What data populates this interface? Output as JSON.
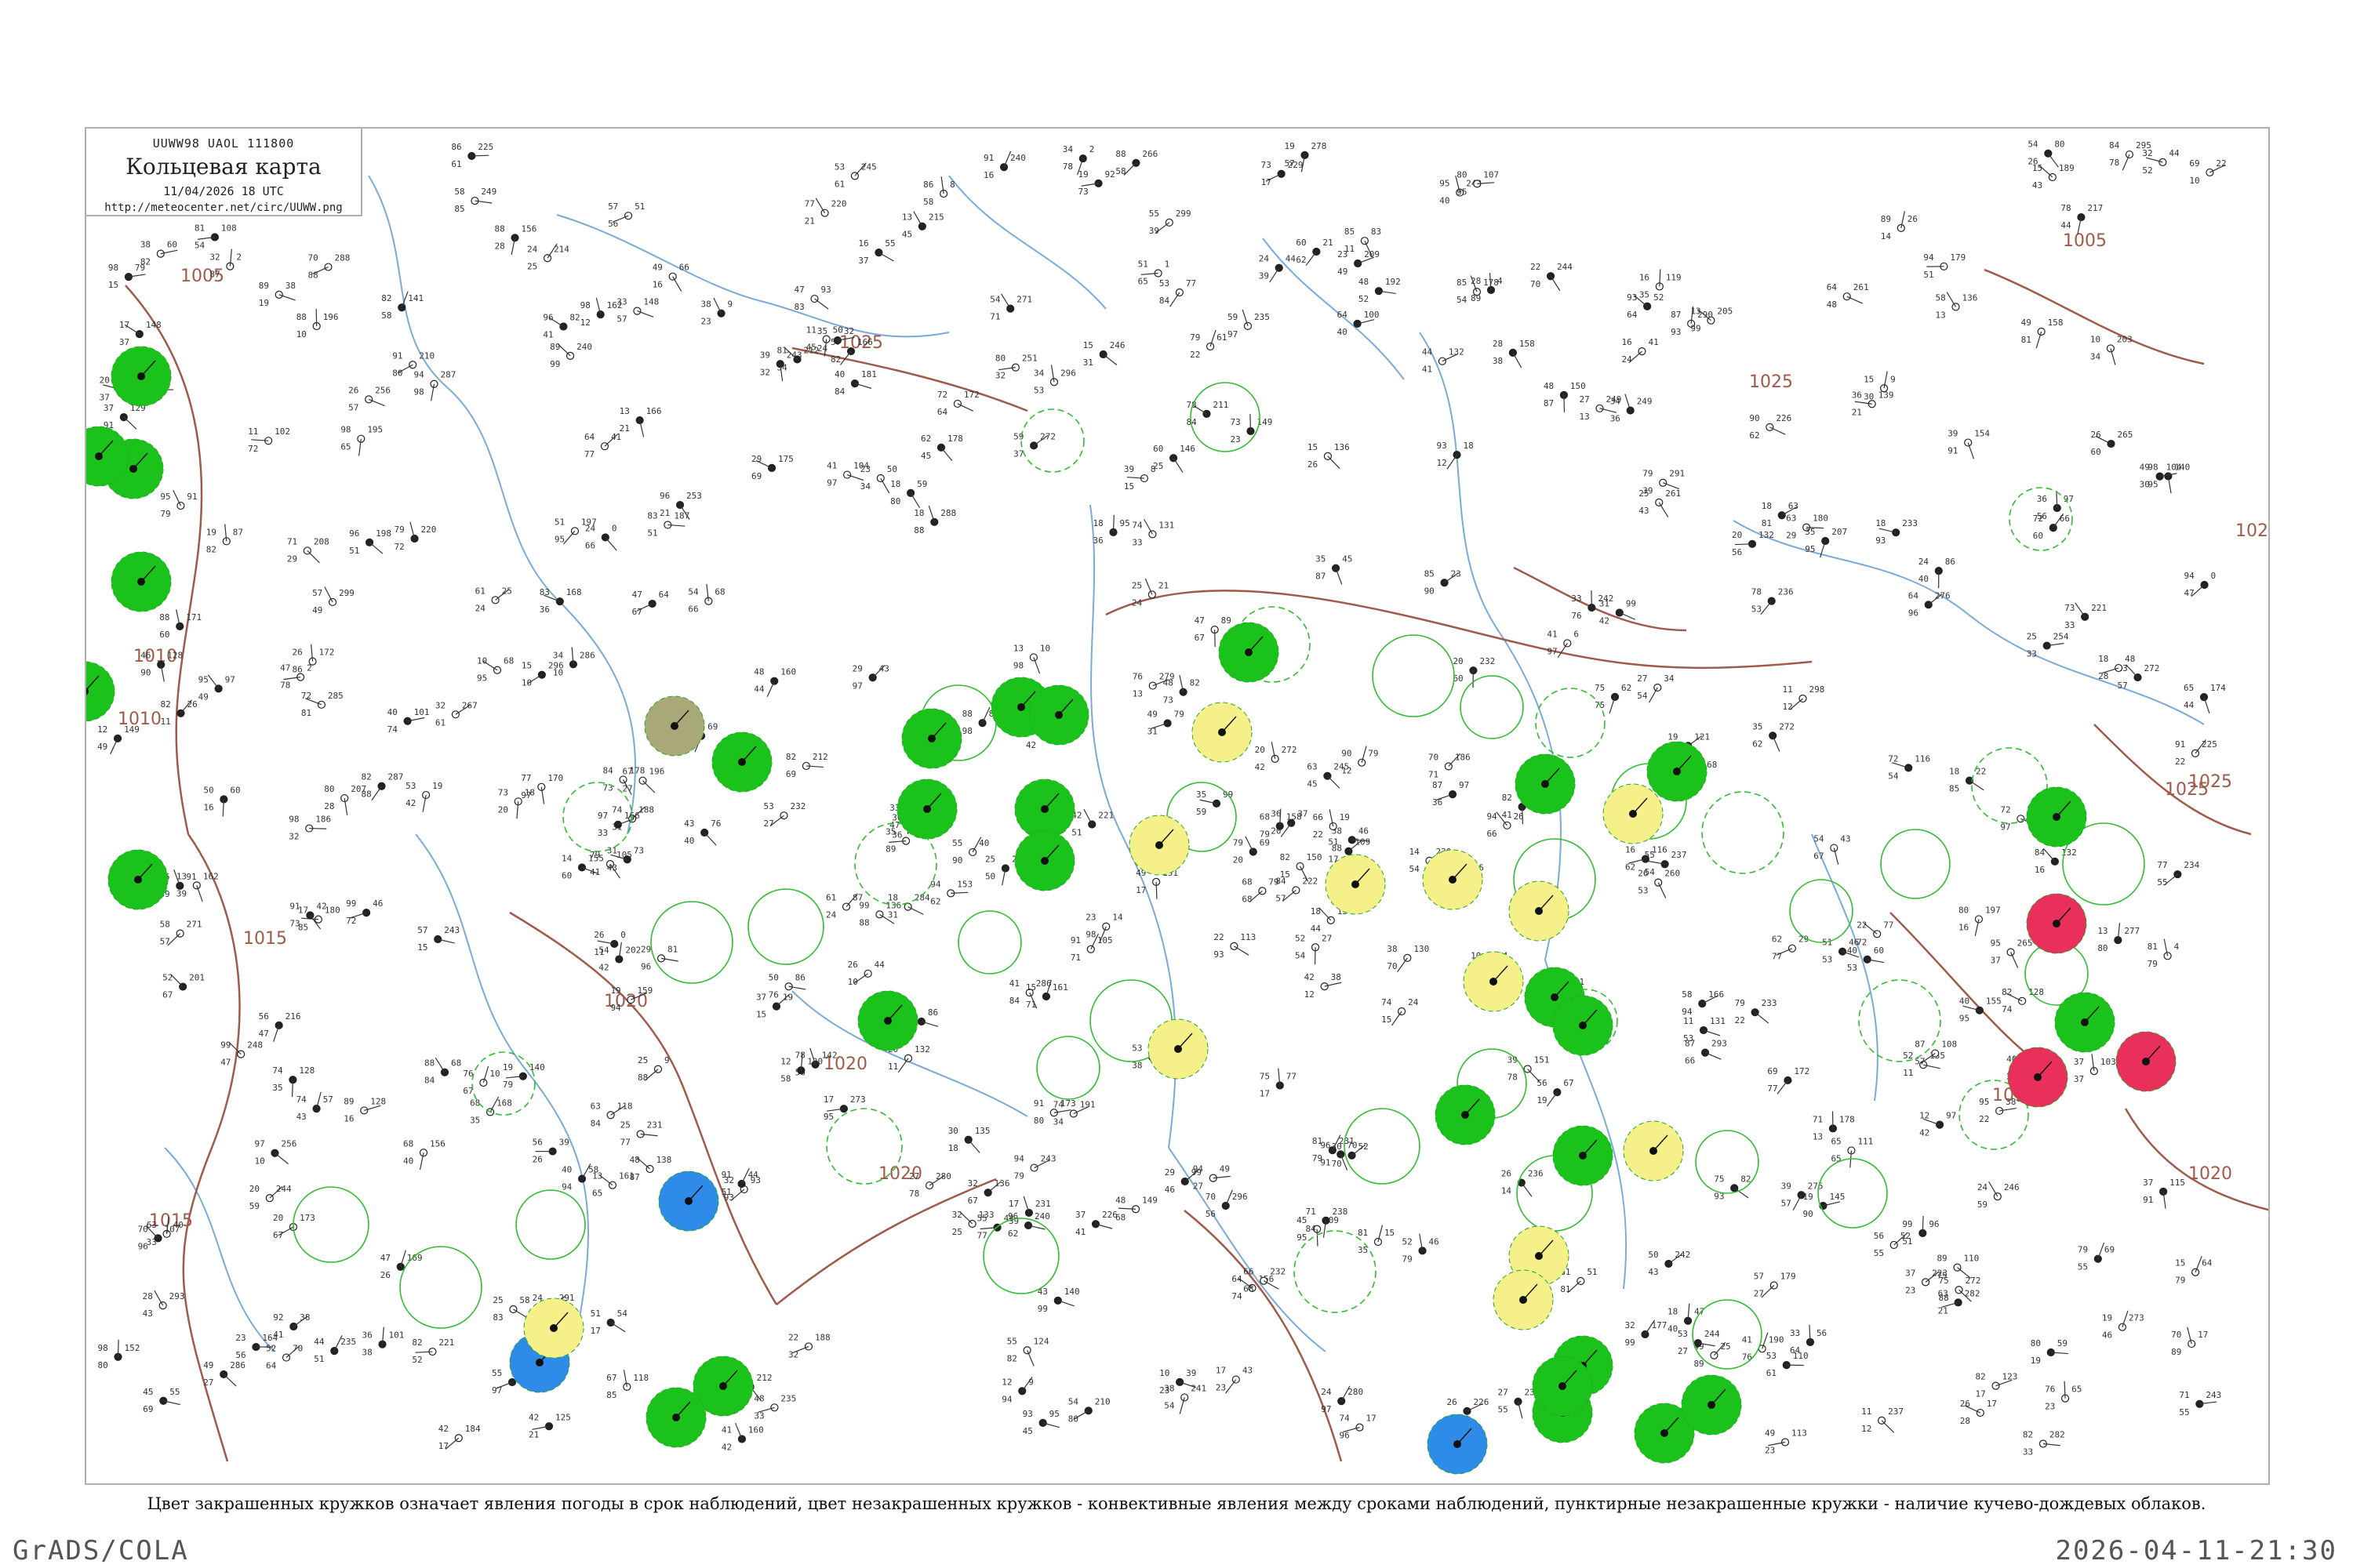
{
  "header": {
    "code": "UUWW98 UAOL 111800",
    "title": "Кольцевая карта",
    "datetime": "11/04/2026 18 UTC",
    "url": "http://meteocenter.net/circ/UUWW.png"
  },
  "legend": {
    "text": "Цвет закрашенных кружков означает явления погоды в срок наблюдений, цвет незакрашенных кружков - конвективные явления между сроками наблюдений, пунктирные незакрашенные кружки - наличие кучево-дождевых облаков."
  },
  "footer": {
    "left": "GrADS/COLA",
    "right": "2026-04-11-21:30"
  },
  "colors": {
    "isobar": "#a05a4a",
    "river": "#7aaad8",
    "rain": "#1cc21c",
    "convective": "#f5f08a",
    "snow": "#2f8be8",
    "thunder": "#e8305a",
    "haze": "#a8a878",
    "shower_ring": "#33bb33"
  },
  "isobar_labels": [
    "1005",
    "1010",
    "1010",
    "1015",
    "1020",
    "1020",
    "1020",
    "1015",
    "1025",
    "1025",
    "1020",
    "1015",
    "1020",
    "1025",
    "1025",
    "102",
    "1005"
  ],
  "stations": {
    "filled_rain": [
      {
        "t": "97",
        "p": "",
        "dp": "10"
      },
      {
        "t": "93",
        "p": "",
        "dp": "17"
      },
      {
        "t": "97",
        "p": "",
        "dp": "27"
      },
      {
        "t": "96",
        "p": "",
        "dp": "10"
      },
      {
        "t": "20",
        "p": "208",
        "dp": "00"
      },
      {
        "t": "96",
        "p": "",
        "dp": "20"
      },
      {
        "t": "91",
        "p": "",
        "dp": "29"
      },
      {
        "t": "96",
        "p": "",
        "dp": "19"
      },
      {
        "t": "97",
        "p": "",
        "dp": "10"
      },
      {
        "t": "96",
        "p": "",
        "dp": "10"
      },
      {
        "t": "97",
        "p": "",
        "dp": "19"
      },
      {
        "t": "96",
        "p": "",
        "dp": "10"
      }
    ],
    "convective": [
      {
        "t": "20",
        "p": "219",
        "dp": "97"
      },
      {
        "t": "08",
        "p": "205",
        "dp": "96"
      },
      {
        "t": "42",
        "p": "205",
        "dp": "96"
      },
      {
        "t": "40",
        "p": "256",
        "dp": "96"
      },
      {
        "t": "64",
        "p": "229",
        "dp": "96"
      },
      {
        "t": "93",
        "p": "201",
        "dp": "96"
      },
      {
        "t": "74",
        "p": "206",
        "dp": "96"
      }
    ],
    "snow": [
      {
        "t": "06",
        "p": "",
        "dp": "97"
      },
      {
        "t": "",
        "p": "",
        "dp": "96"
      }
    ],
    "thunder": [
      {
        "t": "",
        "p": "",
        "dp": ""
      }
    ],
    "haze": [
      {
        "t": "",
        "p": "197",
        "dp": ""
      }
    ]
  }
}
